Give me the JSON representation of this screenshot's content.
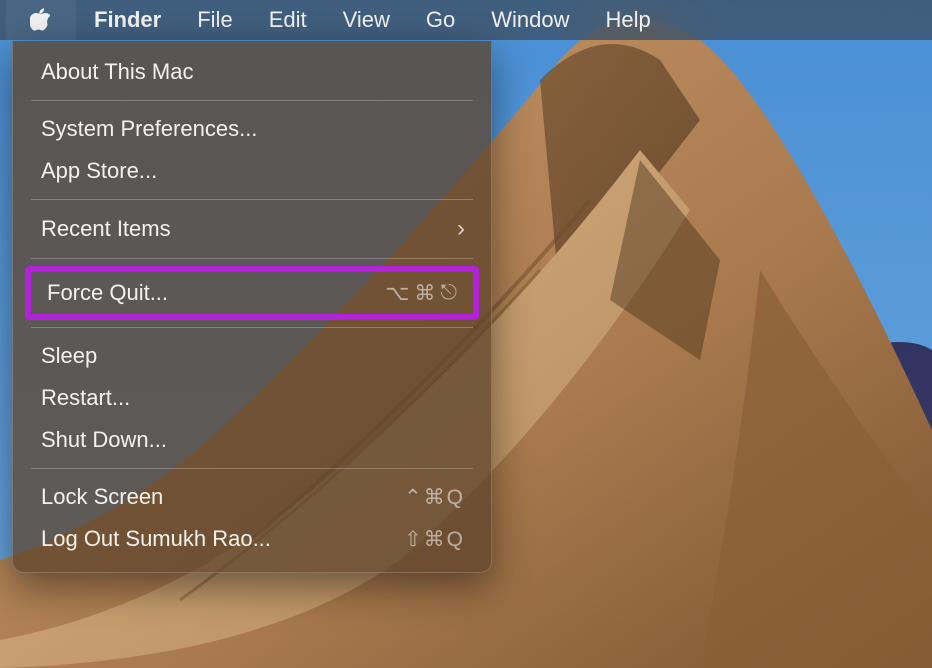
{
  "menubar": {
    "items": [
      {
        "name": "finder",
        "label": "Finder",
        "bold": true
      },
      {
        "name": "file",
        "label": "File"
      },
      {
        "name": "edit",
        "label": "Edit"
      },
      {
        "name": "view",
        "label": "View"
      },
      {
        "name": "go",
        "label": "Go"
      },
      {
        "name": "window",
        "label": "Window"
      },
      {
        "name": "help",
        "label": "Help"
      }
    ]
  },
  "apple_menu": {
    "about": "About This Mac",
    "sys_prefs": "System Preferences...",
    "app_store": "App Store...",
    "recent_items": "Recent Items",
    "force_quit": {
      "label": "Force Quit...",
      "shortcut": "⌥⌘⎋"
    },
    "sleep": "Sleep",
    "restart": "Restart...",
    "shutdown": "Shut Down...",
    "lock_screen": {
      "label": "Lock Screen",
      "shortcut": "⌃⌘Q"
    },
    "log_out": {
      "label": "Log Out Sumukh Rao...",
      "shortcut": "⇧⌘Q"
    }
  },
  "highlight": "force_quit",
  "colors": {
    "highlight_border": "#b122d8",
    "menubar_bg": "rgba(60,75,92,0.72)",
    "dropdown_bg": "rgba(92,66,42,0.75)"
  }
}
